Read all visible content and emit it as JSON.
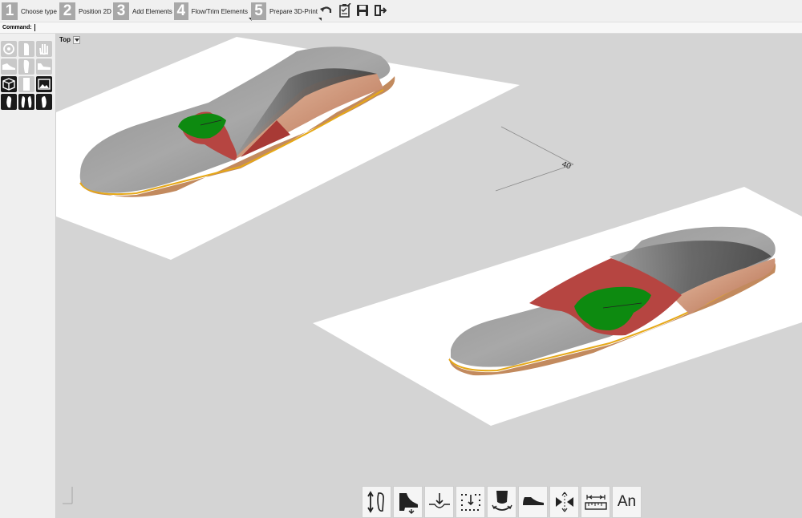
{
  "toolbar": {
    "steps": [
      {
        "num": "1",
        "label": "Choose type"
      },
      {
        "num": "2",
        "label": "Position 2D"
      },
      {
        "num": "3",
        "label": "Add Elements"
      },
      {
        "num": "4",
        "label": "Flow/Trim Elements"
      },
      {
        "num": "5",
        "label": "Prepare 3D-Print"
      }
    ],
    "icons": [
      "undo-icon",
      "clipboard-check-icon",
      "save-icon",
      "exit-icon"
    ]
  },
  "command": {
    "label": "Command:",
    "value": ""
  },
  "viewport": {
    "view_name": "Top",
    "dimension_label": "40"
  },
  "left_panel": {
    "icons": [
      "target-icon",
      "foot-outline-icon",
      "hand-icon",
      "shoe-side-icon",
      "sole-icon",
      "foot-profile-icon",
      "cube-icon",
      "insole-icon",
      "image-icon",
      "right-foot-icon",
      "both-feet-icon",
      "left-foot-icon"
    ]
  },
  "bottom_bar": {
    "buttons": [
      {
        "icon": "flip-feet-icon"
      },
      {
        "icon": "heel-height-icon"
      },
      {
        "icon": "depth-arrow-icon"
      },
      {
        "icon": "offset-grid-icon"
      },
      {
        "icon": "rotate-heel-icon"
      },
      {
        "icon": "sole-profile-icon"
      },
      {
        "icon": "stretch-icon"
      },
      {
        "icon": "measure-icon"
      },
      {
        "icon": "annotation-icon",
        "text": "An"
      }
    ]
  }
}
